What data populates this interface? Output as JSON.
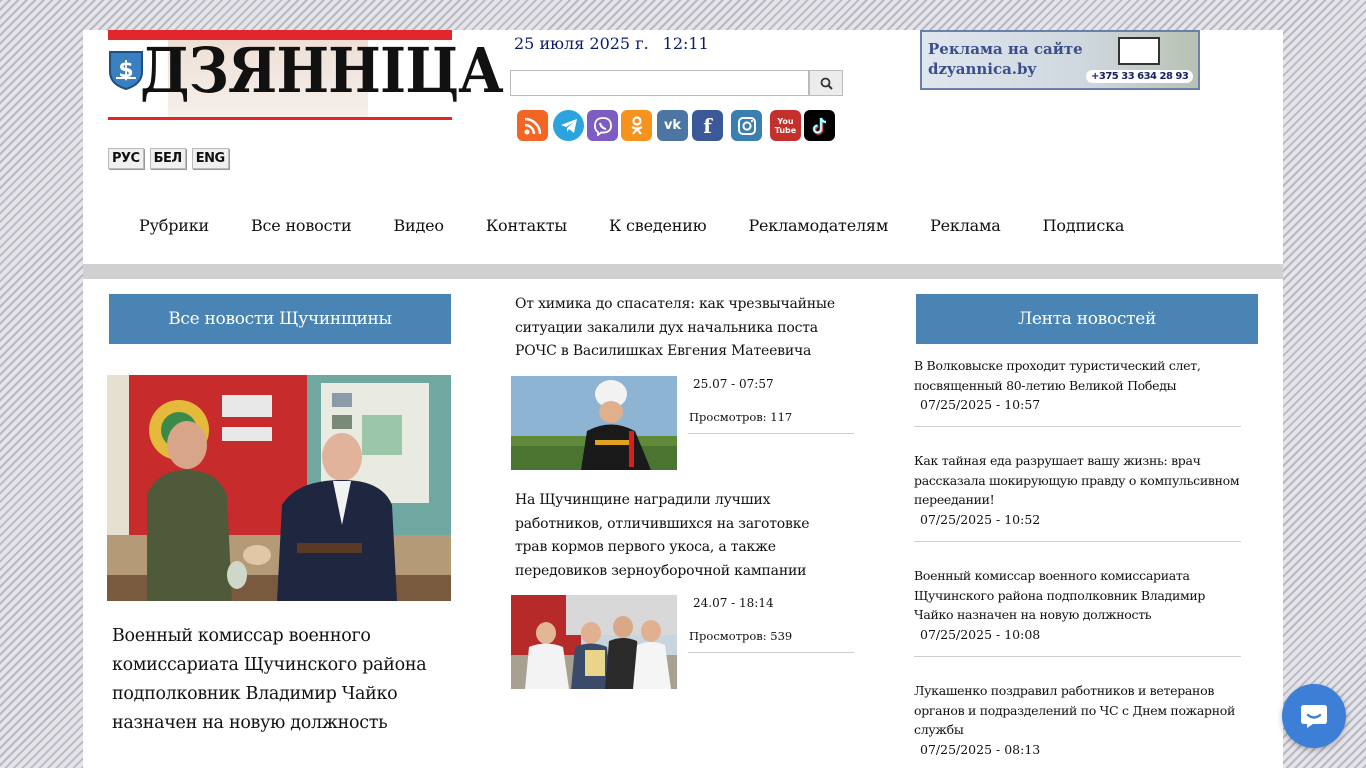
{
  "site": {
    "logo_text": "ДЗЯННІЦА",
    "languages": [
      "РУС",
      "БЕЛ",
      "ENG"
    ],
    "date": "25 июля 2025 г.",
    "time": "12:11",
    "search": {
      "placeholder": "",
      "value": ""
    },
    "socials": [
      "rss-icon",
      "telegram-icon",
      "viber-icon",
      "odnoklassniki-icon",
      "vk-icon",
      "facebook-icon",
      "instagram-icon",
      "youtube-icon",
      "tiktok-icon"
    ],
    "ad": {
      "line1": "Реклама на сайте",
      "line2": "dzyannica.by",
      "phone": "+375 33 634 28 93"
    },
    "brand_color": "#4984b5",
    "accent_red": "#e2262b"
  },
  "nav": [
    "Рубрики",
    "Все новости",
    "Видео",
    "Контакты",
    "К сведению",
    "Рекламодателям",
    "Реклама",
    "Подписка"
  ],
  "left": {
    "heading": "Все новости Щучинщины",
    "main_title": "Военный комиссар военного комиссариата Щучинского района подполковник Владимир Чайко назначен на новую должность"
  },
  "middle": [
    {
      "title": "От химика до спасателя: как чрезвычайные ситуации закалили дух начальника поста РОЧС в Василишках Евгения Матеевича",
      "date": "25.07 - 07:57",
      "views": "Просмотров: 117"
    },
    {
      "title": "На Щучинщине наградили лучших работников, отличившихся на заготовке трав кормов первого укоса, а также передовиков зерноуборочной кампании",
      "date": "24.07 - 18:14",
      "views": "Просмотров: 539"
    }
  ],
  "right": {
    "heading": "Лента новостей",
    "items": [
      {
        "title": "В Волковыске проходит туристический слет, посвященный 80-летию Великой Победы",
        "time": "07/25/2025 - 10:57"
      },
      {
        "title": "Как тайная еда разрушает вашу жизнь: врач рассказала шокирующую правду о компульсивном переедании!",
        "time": "07/25/2025 - 10:52"
      },
      {
        "title": "Военный комиссар военного комиссариата Щучинского района подполковник Владимир Чайко назначен на новую должность",
        "time": "07/25/2025 - 10:08"
      },
      {
        "title": "Лукашенко поздравил работников и ветеранов органов и подразделений по ЧС с Днем пожарной службы",
        "time": "07/25/2025 - 08:13"
      }
    ]
  }
}
